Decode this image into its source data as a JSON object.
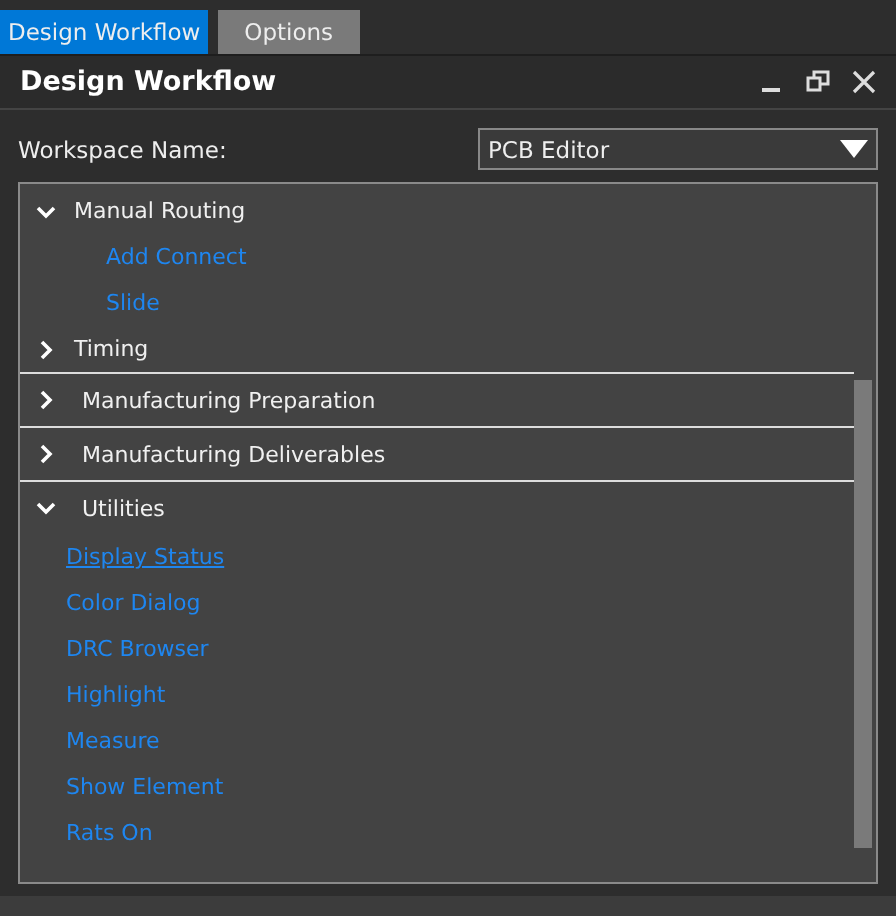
{
  "tabs": [
    {
      "label": "Design Workflow",
      "selected": true
    },
    {
      "label": "Options",
      "selected": false
    }
  ],
  "panel": {
    "title": "Design Workflow"
  },
  "workspace": {
    "label": "Workspace Name:",
    "value": "PCB Editor"
  },
  "sections": [
    {
      "kind": "subsection",
      "label": "Manual Routing",
      "expanded": true,
      "items": [
        {
          "label": "Add Connect",
          "hovered": false
        },
        {
          "label": "Slide",
          "hovered": false
        }
      ]
    },
    {
      "kind": "subsection",
      "label": "Timing",
      "expanded": false
    },
    {
      "kind": "section",
      "label": "Manufacturing Preparation",
      "expanded": false
    },
    {
      "kind": "section",
      "label": "Manufacturing Deliverables",
      "expanded": false
    },
    {
      "kind": "section",
      "label": "Utilities",
      "expanded": true,
      "items": [
        {
          "label": "Display Status",
          "hovered": true
        },
        {
          "label": "Color Dialog",
          "hovered": false
        },
        {
          "label": "DRC Browser",
          "hovered": false
        },
        {
          "label": "Highlight",
          "hovered": false
        },
        {
          "label": "Measure",
          "hovered": false
        },
        {
          "label": "Show Element",
          "hovered": false
        },
        {
          "label": "Rats On",
          "hovered": false
        }
      ]
    }
  ]
}
